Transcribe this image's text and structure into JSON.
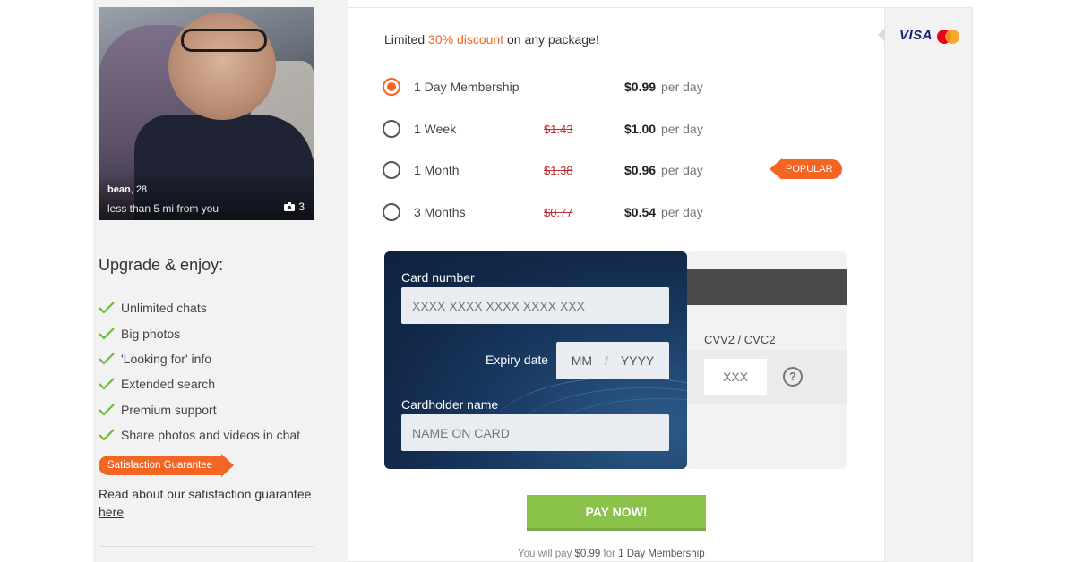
{
  "profile": {
    "name": "bean",
    "age": "28",
    "distance": "less than 5 mi from you",
    "photo_count": "3"
  },
  "upgrade": {
    "title": "Upgrade & enjoy:",
    "features": [
      "Unlimited chats",
      "Big photos",
      "'Looking for' info",
      "Extended search",
      "Premium support",
      "Share photos and videos in chat"
    ],
    "guarantee_badge": "Satisfaction Guarantee",
    "guarantee_text": "Read about our satisfaction guarantee",
    "guarantee_link": "here"
  },
  "promo": {
    "prefix": "Limited",
    "highlight": "30% discount",
    "suffix": "on any package!"
  },
  "plans": [
    {
      "name": "1 Day Membership",
      "old_price": "",
      "price": "$0.99",
      "per": "per day",
      "selected": true,
      "badge": ""
    },
    {
      "name": "1 Week",
      "old_price": "$1.43",
      "price": "$1.00",
      "per": "per day",
      "selected": false,
      "badge": ""
    },
    {
      "name": "1 Month",
      "old_price": "$1.38",
      "price": "$0.96",
      "per": "per day",
      "selected": false,
      "badge": "POPULAR"
    },
    {
      "name": "3 Months",
      "old_price": "$0.77",
      "price": "$0.54",
      "per": "per day",
      "selected": false,
      "badge": ""
    }
  ],
  "card": {
    "number_label": "Card number",
    "number_placeholder": "XXXX XXXX XXXX XXXX XXX",
    "expiry_label": "Expiry date",
    "expiry_month": "MM",
    "expiry_sep": "/",
    "expiry_year": "YYYY",
    "holder_label": "Cardholder name",
    "holder_placeholder": "NAME ON CARD",
    "cvv_label": "CVV2 / CVC2",
    "cvv_placeholder": "XXX",
    "help": "?"
  },
  "payment": {
    "button": "PAY NOW!",
    "summary_prefix": "You will pay",
    "summary_amount": "$0.99",
    "summary_for": "for",
    "summary_plan": "1 Day Membership"
  },
  "brands": {
    "visa": "VISA",
    "mastercard_icon": "mastercard-logo"
  },
  "colors": {
    "accent": "#f26522",
    "pay_button": "#8bc34a",
    "card_bg": "#12294a",
    "check": "#6dbb3a"
  }
}
